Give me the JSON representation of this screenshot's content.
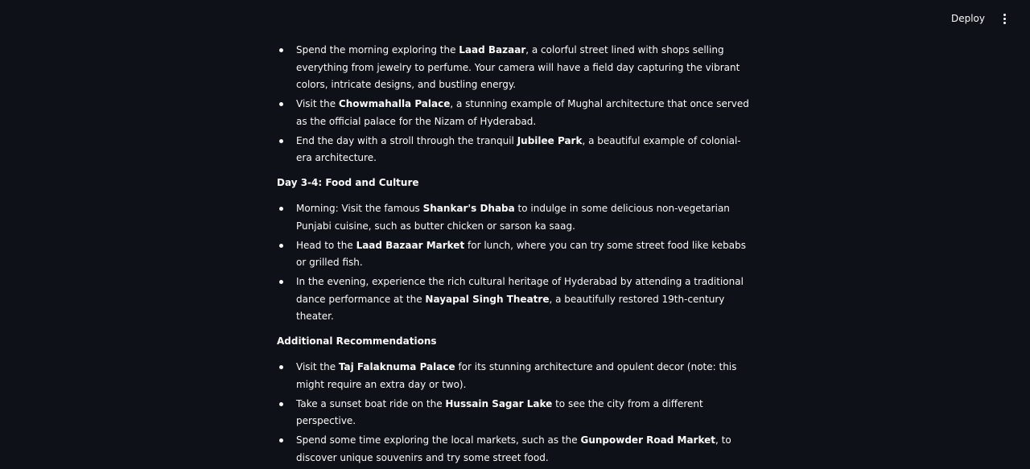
{
  "header": {
    "deploy_label": "Deploy"
  },
  "sections": [
    {
      "heading": "",
      "items": [
        [
          {
            "t": "Spend the morning exploring the "
          },
          {
            "t": "Laad Bazaar",
            "b": true
          },
          {
            "t": ", a colorful street lined with shops selling everything from jewelry to perfume. Your camera will have a field day capturing the vibrant colors, intricate designs, and bustling energy."
          }
        ],
        [
          {
            "t": "Visit the "
          },
          {
            "t": "Chowmahalla Palace",
            "b": true
          },
          {
            "t": ", a stunning example of Mughal architecture that once served as the official palace for the Nizam of Hyderabad."
          }
        ],
        [
          {
            "t": "End the day with a stroll through the tranquil "
          },
          {
            "t": "Jubilee Park",
            "b": true
          },
          {
            "t": ", a beautiful example of colonial-era architecture."
          }
        ]
      ]
    },
    {
      "heading": "Day 3-4: Food and Culture",
      "items": [
        [
          {
            "t": "Morning: Visit the famous "
          },
          {
            "t": "Shankar's Dhaba",
            "b": true
          },
          {
            "t": " to indulge in some delicious non-vegetarian Punjabi cuisine, such as butter chicken or sarson ka saag."
          }
        ],
        [
          {
            "t": "Head to the "
          },
          {
            "t": "Laad Bazaar Market",
            "b": true
          },
          {
            "t": " for lunch, where you can try some street food like kebabs or grilled fish."
          }
        ],
        [
          {
            "t": "In the evening, experience the rich cultural heritage of Hyderabad by attending a traditional dance performance at the "
          },
          {
            "t": "Nayapal Singh Theatre",
            "b": true
          },
          {
            "t": ", a beautifully restored 19th-century theater."
          }
        ]
      ]
    },
    {
      "heading": "Additional Recommendations",
      "items": [
        [
          {
            "t": "Visit the "
          },
          {
            "t": "Taj Falaknuma Palace",
            "b": true
          },
          {
            "t": " for its stunning architecture and opulent decor (note: this might require an extra day or two)."
          }
        ],
        [
          {
            "t": "Take a sunset boat ride on the "
          },
          {
            "t": "Hussain Sagar Lake",
            "b": true
          },
          {
            "t": " to see the city from a different perspective."
          }
        ],
        [
          {
            "t": "Spend some time exploring the local markets, such as the "
          },
          {
            "t": "Gunpowder Road Market",
            "b": true
          },
          {
            "t": ", to discover unique souvenirs and try some street food."
          }
        ]
      ]
    }
  ]
}
